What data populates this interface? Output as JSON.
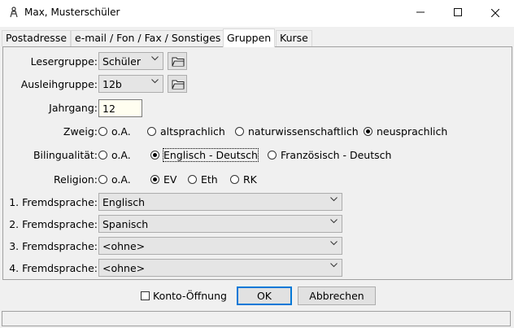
{
  "window": {
    "title": "Max, Musterschüler"
  },
  "tabs": [
    "Postadresse",
    "e-mail / Fon / Fax / Sonstiges",
    "Gruppen",
    "Kurse"
  ],
  "form": {
    "lesergruppe": {
      "label": "Lesergruppe:",
      "value": "Schüler"
    },
    "ausleihgruppe": {
      "label": "Ausleihgruppe:",
      "value": "12b"
    },
    "jahrgang": {
      "label": "Jahrgang:",
      "value": "12"
    },
    "zweig": {
      "label": "Zweig:",
      "options": [
        "o.A.",
        "altsprachlich",
        "naturwissenschaftlich",
        "neusprachlich"
      ],
      "selected": "neusprachlich"
    },
    "bilingualitaet": {
      "label": "Bilingualität:",
      "options": [
        "o.A.",
        "Englisch - Deutsch",
        "Französisch - Deutsch"
      ],
      "selected": "Englisch - Deutsch"
    },
    "religion": {
      "label": "Religion:",
      "options": [
        "o.A.",
        "EV",
        "Eth",
        "RK"
      ],
      "selected": "EV"
    },
    "fremdsprachen": [
      {
        "label": "1. Fremdsprache:",
        "value": "Englisch"
      },
      {
        "label": "2. Fremdsprache:",
        "value": "Spanisch"
      },
      {
        "label": "3. Fremdsprache:",
        "value": "<ohne>"
      },
      {
        "label": "4. Fremdsprache:",
        "value": "<ohne>"
      }
    ]
  },
  "footer": {
    "konto_label": "Konto-Öffnung",
    "konto_checked": false,
    "ok_label": "OK",
    "cancel_label": "Abbrechen"
  }
}
